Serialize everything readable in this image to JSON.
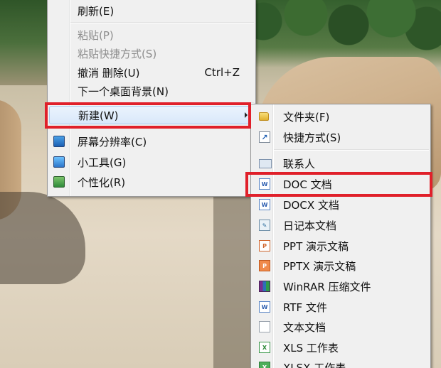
{
  "main_menu": {
    "refresh": "刷新(E)",
    "paste": "粘贴(P)",
    "paste_shortcut": "粘贴快捷方式(S)",
    "undo_delete": "撤消 删除(U)",
    "undo_shortcut": "Ctrl+Z",
    "next_background": "下一个桌面背景(N)",
    "new": "新建(W)",
    "screen_resolution": "屏幕分辨率(C)",
    "gadgets": "小工具(G)",
    "personalize": "个性化(R)"
  },
  "new_submenu": {
    "items": [
      {
        "label": "文件夹(F)",
        "icon": "folder-icon"
      },
      {
        "label": "快捷方式(S)",
        "icon": "shortcut-icon"
      },
      {
        "label": "联系人",
        "icon": "contact-icon"
      },
      {
        "label": "DOC 文档",
        "icon": "word-doc-icon"
      },
      {
        "label": "DOCX 文档",
        "icon": "word-docx-icon"
      },
      {
        "label": "日记本文档",
        "icon": "journal-icon"
      },
      {
        "label": "PPT 演示文稿",
        "icon": "ppt-icon"
      },
      {
        "label": "PPTX 演示文稿",
        "icon": "pptx-icon"
      },
      {
        "label": "WinRAR 压缩文件",
        "icon": "winrar-icon"
      },
      {
        "label": "RTF 文件",
        "icon": "rtf-icon"
      },
      {
        "label": "文本文档",
        "icon": "text-doc-icon"
      },
      {
        "label": "XLS 工作表",
        "icon": "xls-icon"
      },
      {
        "label": "XLSX 工作表",
        "icon": "xlsx-icon"
      }
    ]
  },
  "colors": {
    "menu_bg": "#f0f0f0",
    "highlight_red": "#e0202a",
    "hover_blue": "#d9e8fa"
  }
}
